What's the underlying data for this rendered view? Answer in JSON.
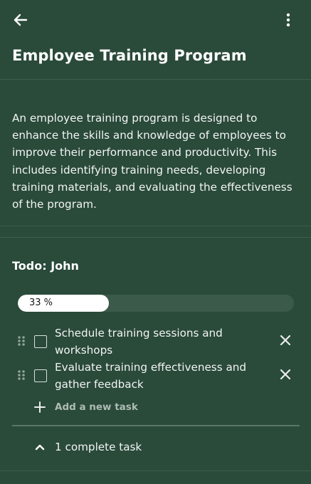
{
  "colors": {
    "background": "#2a4a3a",
    "progress_track": "#3c5a4a",
    "progress_fill": "#ffffff"
  },
  "header": {
    "back_icon": "arrow-left-icon",
    "menu_icon": "more-vertical-icon"
  },
  "page": {
    "title": "Employee Training Program",
    "description": "An employee training program is designed to enhance the skills and knowledge of employees to improve their performance and productivity. This includes identifying training needs, developing training materials, and evaluating the effectiveness of the program."
  },
  "todo": {
    "title": "Todo: John",
    "progress_label": "33 %",
    "progress_fraction": 0.33,
    "tasks": [
      {
        "text": "Schedule training sessions and workshops",
        "checked": false
      },
      {
        "text": "Evaluate training effectiveness and gather feedback",
        "checked": false
      }
    ],
    "add_task_label": "Add a new task",
    "completed_label": "1 complete task"
  }
}
